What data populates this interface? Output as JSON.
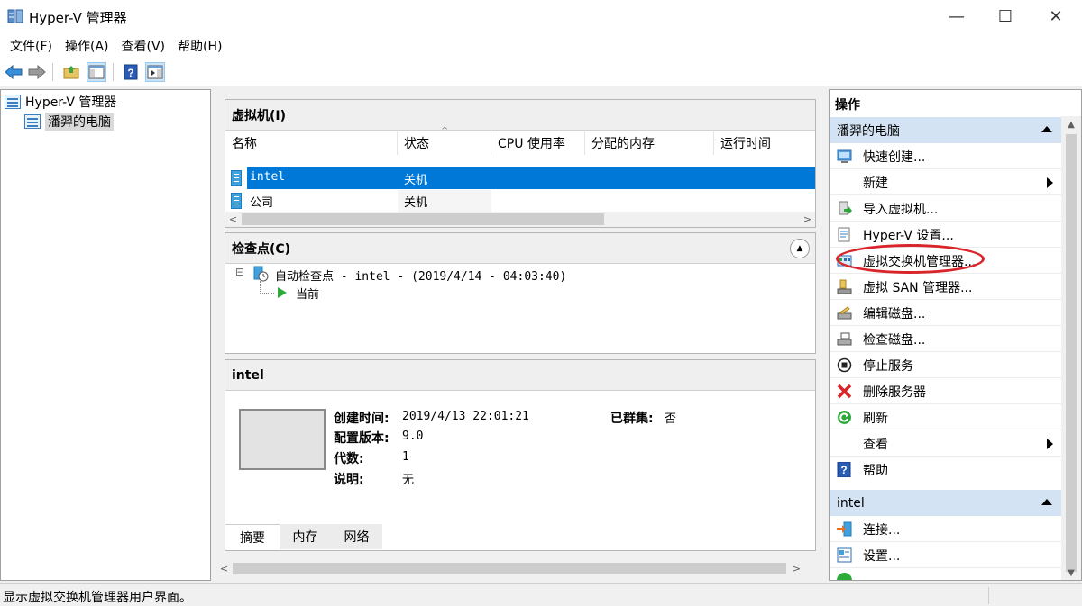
{
  "window": {
    "title": "Hyper-V 管理器",
    "minimize_glyph": "—",
    "maximize_glyph": "☐",
    "close_glyph": "✕"
  },
  "menu": [
    "文件(F)",
    "操作(A)",
    "查看(V)",
    "帮助(H)"
  ],
  "toolbar": {
    "icons": [
      "back-arrow-icon",
      "forward-arrow-icon",
      "up-folder-icon",
      "console-tree-icon",
      "help-icon",
      "action-pane-icon"
    ]
  },
  "tree": {
    "root": "Hyper-V 管理器",
    "child": "潘羿的电脑"
  },
  "vm_section": {
    "title": "虚拟机(I)",
    "columns": [
      "名称",
      "状态",
      "CPU 使用率",
      "分配的内存",
      "运行时间"
    ],
    "sort_glyph": "^",
    "rows": [
      {
        "name": "intel",
        "state": "关机",
        "selected": true
      },
      {
        "name": "公司",
        "state": "关机",
        "selected": false
      }
    ],
    "scroll_left": "<",
    "scroll_right": ">"
  },
  "checkpoint_section": {
    "title": "检查点(C)",
    "collapse_glyph": "▲",
    "expander_glyph": "⊟",
    "checkpoint_label": "自动检查点 - intel - (2019/4/14 - 04:03:40)",
    "current_label": "当前"
  },
  "details": {
    "title": "intel",
    "fields": [
      {
        "label": "创建时间:",
        "value": "2019/4/13 22:01:21"
      },
      {
        "label": "配置版本:",
        "value": "9.0"
      },
      {
        "label": "代数:",
        "value": "1"
      },
      {
        "label": "说明:",
        "value": "无"
      }
    ],
    "cluster_label": "已群集:",
    "cluster_value": "否",
    "tabs": [
      "摘要",
      "内存",
      "网络"
    ]
  },
  "middle_scroll": {
    "left": "<",
    "right": ">"
  },
  "actions": {
    "title": "操作",
    "group1": "潘羿的电脑",
    "group1_items": [
      {
        "label": "快速创建...",
        "icon": "quick-create-icon"
      },
      {
        "label": "新建",
        "icon": "none",
        "submenu": true
      },
      {
        "label": "导入虚拟机...",
        "icon": "import-vm-icon"
      },
      {
        "label": "Hyper-V 设置...",
        "icon": "settings-document-icon"
      },
      {
        "label": "虚拟交换机管理器...",
        "icon": "virtual-switch-icon"
      },
      {
        "label": "虚拟 SAN 管理器...",
        "icon": "san-icon"
      },
      {
        "label": "编辑磁盘...",
        "icon": "edit-disk-icon"
      },
      {
        "label": "检查磁盘...",
        "icon": "inspect-disk-icon"
      },
      {
        "label": "停止服务",
        "icon": "stop-service-icon"
      },
      {
        "label": "删除服务器",
        "icon": "delete-x-icon"
      },
      {
        "label": "刷新",
        "icon": "refresh-icon"
      },
      {
        "label": "查看",
        "icon": "none",
        "submenu": true
      },
      {
        "label": "帮助",
        "icon": "help-icon"
      }
    ],
    "group2": "intel",
    "group2_items": [
      {
        "label": "连接...",
        "icon": "connect-icon"
      },
      {
        "label": "设置...",
        "icon": "vm-settings-icon"
      }
    ],
    "scroll_up": "▲",
    "scroll_down": "▼",
    "highlight_color": "#d9242a"
  },
  "status": {
    "text": "显示虚拟交换机管理器用户界面。"
  }
}
